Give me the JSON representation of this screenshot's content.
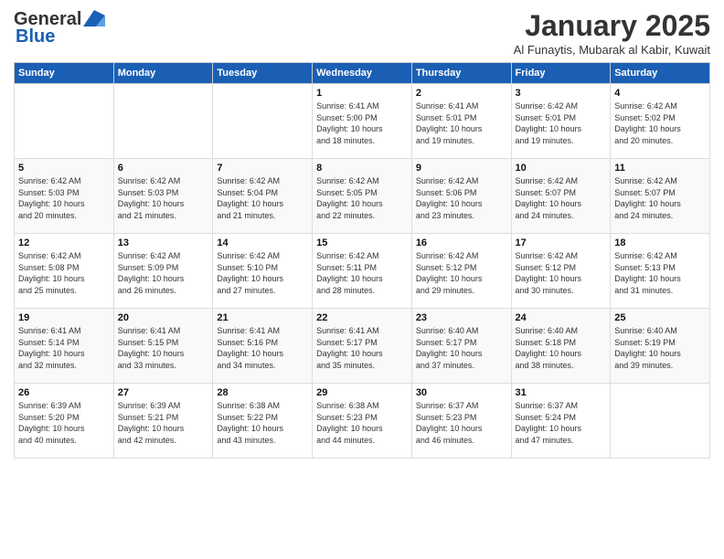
{
  "logo": {
    "line1": "General",
    "line2": "Blue"
  },
  "header": {
    "month": "January 2025",
    "location": "Al Funaytis, Mubarak al Kabir, Kuwait"
  },
  "days_of_week": [
    "Sunday",
    "Monday",
    "Tuesday",
    "Wednesday",
    "Thursday",
    "Friday",
    "Saturday"
  ],
  "weeks": [
    [
      {
        "day": "",
        "info": ""
      },
      {
        "day": "",
        "info": ""
      },
      {
        "day": "",
        "info": ""
      },
      {
        "day": "1",
        "info": "Sunrise: 6:41 AM\nSunset: 5:00 PM\nDaylight: 10 hours\nand 18 minutes."
      },
      {
        "day": "2",
        "info": "Sunrise: 6:41 AM\nSunset: 5:01 PM\nDaylight: 10 hours\nand 19 minutes."
      },
      {
        "day": "3",
        "info": "Sunrise: 6:42 AM\nSunset: 5:01 PM\nDaylight: 10 hours\nand 19 minutes."
      },
      {
        "day": "4",
        "info": "Sunrise: 6:42 AM\nSunset: 5:02 PM\nDaylight: 10 hours\nand 20 minutes."
      }
    ],
    [
      {
        "day": "5",
        "info": "Sunrise: 6:42 AM\nSunset: 5:03 PM\nDaylight: 10 hours\nand 20 minutes."
      },
      {
        "day": "6",
        "info": "Sunrise: 6:42 AM\nSunset: 5:03 PM\nDaylight: 10 hours\nand 21 minutes."
      },
      {
        "day": "7",
        "info": "Sunrise: 6:42 AM\nSunset: 5:04 PM\nDaylight: 10 hours\nand 21 minutes."
      },
      {
        "day": "8",
        "info": "Sunrise: 6:42 AM\nSunset: 5:05 PM\nDaylight: 10 hours\nand 22 minutes."
      },
      {
        "day": "9",
        "info": "Sunrise: 6:42 AM\nSunset: 5:06 PM\nDaylight: 10 hours\nand 23 minutes."
      },
      {
        "day": "10",
        "info": "Sunrise: 6:42 AM\nSunset: 5:07 PM\nDaylight: 10 hours\nand 24 minutes."
      },
      {
        "day": "11",
        "info": "Sunrise: 6:42 AM\nSunset: 5:07 PM\nDaylight: 10 hours\nand 24 minutes."
      }
    ],
    [
      {
        "day": "12",
        "info": "Sunrise: 6:42 AM\nSunset: 5:08 PM\nDaylight: 10 hours\nand 25 minutes."
      },
      {
        "day": "13",
        "info": "Sunrise: 6:42 AM\nSunset: 5:09 PM\nDaylight: 10 hours\nand 26 minutes."
      },
      {
        "day": "14",
        "info": "Sunrise: 6:42 AM\nSunset: 5:10 PM\nDaylight: 10 hours\nand 27 minutes."
      },
      {
        "day": "15",
        "info": "Sunrise: 6:42 AM\nSunset: 5:11 PM\nDaylight: 10 hours\nand 28 minutes."
      },
      {
        "day": "16",
        "info": "Sunrise: 6:42 AM\nSunset: 5:12 PM\nDaylight: 10 hours\nand 29 minutes."
      },
      {
        "day": "17",
        "info": "Sunrise: 6:42 AM\nSunset: 5:12 PM\nDaylight: 10 hours\nand 30 minutes."
      },
      {
        "day": "18",
        "info": "Sunrise: 6:42 AM\nSunset: 5:13 PM\nDaylight: 10 hours\nand 31 minutes."
      }
    ],
    [
      {
        "day": "19",
        "info": "Sunrise: 6:41 AM\nSunset: 5:14 PM\nDaylight: 10 hours\nand 32 minutes."
      },
      {
        "day": "20",
        "info": "Sunrise: 6:41 AM\nSunset: 5:15 PM\nDaylight: 10 hours\nand 33 minutes."
      },
      {
        "day": "21",
        "info": "Sunrise: 6:41 AM\nSunset: 5:16 PM\nDaylight: 10 hours\nand 34 minutes."
      },
      {
        "day": "22",
        "info": "Sunrise: 6:41 AM\nSunset: 5:17 PM\nDaylight: 10 hours\nand 35 minutes."
      },
      {
        "day": "23",
        "info": "Sunrise: 6:40 AM\nSunset: 5:17 PM\nDaylight: 10 hours\nand 37 minutes."
      },
      {
        "day": "24",
        "info": "Sunrise: 6:40 AM\nSunset: 5:18 PM\nDaylight: 10 hours\nand 38 minutes."
      },
      {
        "day": "25",
        "info": "Sunrise: 6:40 AM\nSunset: 5:19 PM\nDaylight: 10 hours\nand 39 minutes."
      }
    ],
    [
      {
        "day": "26",
        "info": "Sunrise: 6:39 AM\nSunset: 5:20 PM\nDaylight: 10 hours\nand 40 minutes."
      },
      {
        "day": "27",
        "info": "Sunrise: 6:39 AM\nSunset: 5:21 PM\nDaylight: 10 hours\nand 42 minutes."
      },
      {
        "day": "28",
        "info": "Sunrise: 6:38 AM\nSunset: 5:22 PM\nDaylight: 10 hours\nand 43 minutes."
      },
      {
        "day": "29",
        "info": "Sunrise: 6:38 AM\nSunset: 5:23 PM\nDaylight: 10 hours\nand 44 minutes."
      },
      {
        "day": "30",
        "info": "Sunrise: 6:37 AM\nSunset: 5:23 PM\nDaylight: 10 hours\nand 46 minutes."
      },
      {
        "day": "31",
        "info": "Sunrise: 6:37 AM\nSunset: 5:24 PM\nDaylight: 10 hours\nand 47 minutes."
      },
      {
        "day": "",
        "info": ""
      }
    ]
  ]
}
